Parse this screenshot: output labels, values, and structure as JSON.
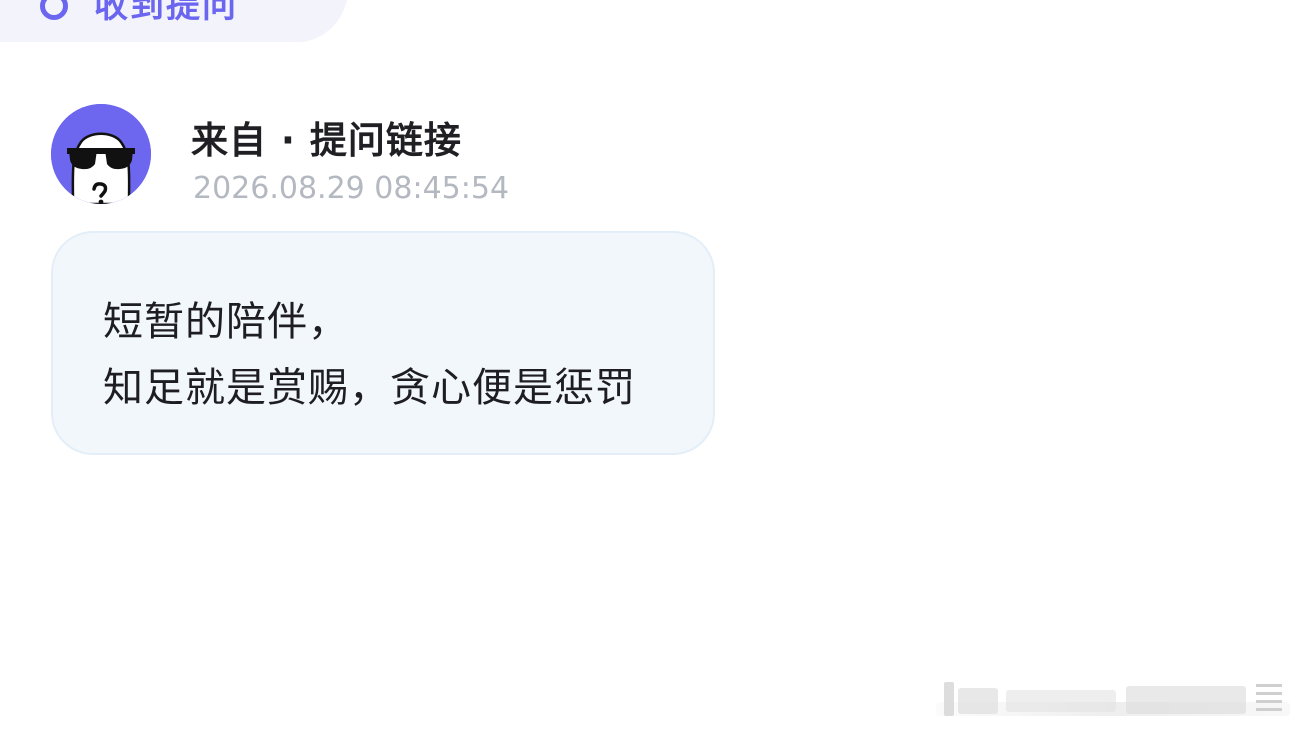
{
  "header": {
    "tab_label": "收到提问"
  },
  "question": {
    "source": "来自 · 提问链接",
    "timestamp": "2026.08.29 08:45:54",
    "message_line1": "短暂的陪伴，",
    "message_line2": "知足就是赏赐，贪心便是惩罚"
  },
  "colors": {
    "accent": "#6b66f0",
    "avatar_bg": "#6c67ee",
    "bubble_bg": "#f2f7fc",
    "timestamp": "#b4b8c0"
  },
  "icons": {
    "tab_icon": "question-circle-icon",
    "avatar": "anonymous-sunglasses-avatar"
  }
}
